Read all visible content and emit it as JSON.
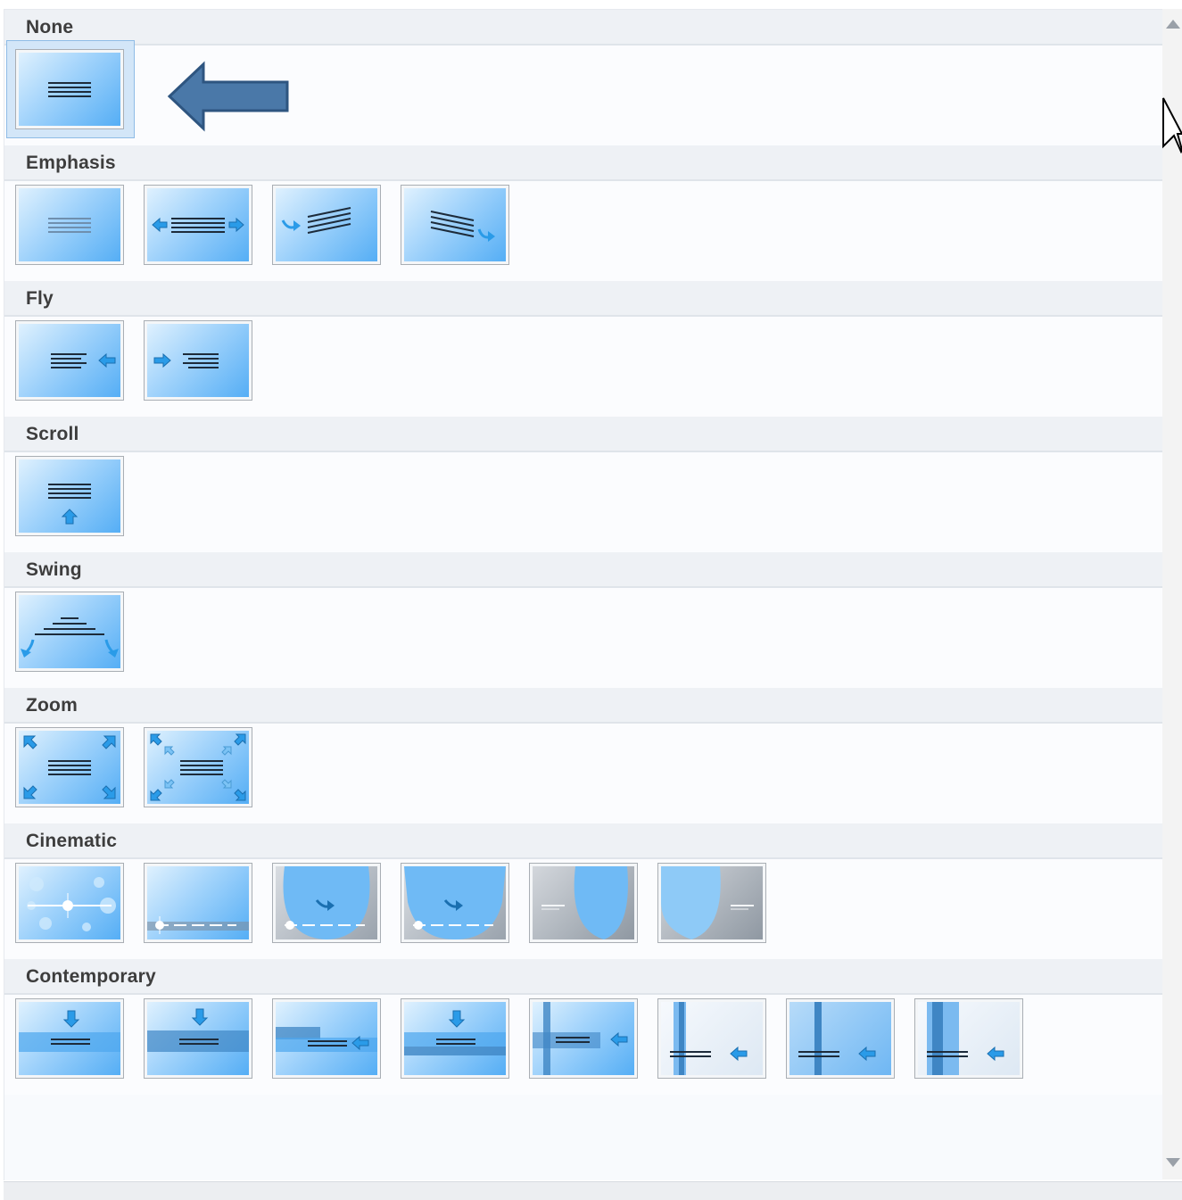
{
  "sections": [
    {
      "label": "None",
      "tiles": [
        {
          "name": "none",
          "selected": true
        }
      ]
    },
    {
      "label": "Emphasis",
      "tiles": [
        {
          "name": "emphasis-1"
        },
        {
          "name": "emphasis-2"
        },
        {
          "name": "emphasis-3"
        },
        {
          "name": "emphasis-4"
        }
      ]
    },
    {
      "label": "Fly",
      "tiles": [
        {
          "name": "fly-1"
        },
        {
          "name": "fly-2"
        }
      ]
    },
    {
      "label": "Scroll",
      "tiles": [
        {
          "name": "scroll-1"
        }
      ]
    },
    {
      "label": "Swing",
      "tiles": [
        {
          "name": "swing-1"
        }
      ]
    },
    {
      "label": "Zoom",
      "tiles": [
        {
          "name": "zoom-1"
        },
        {
          "name": "zoom-2"
        }
      ]
    },
    {
      "label": "Cinematic",
      "tiles": [
        {
          "name": "cinematic-1"
        },
        {
          "name": "cinematic-2"
        },
        {
          "name": "cinematic-3"
        },
        {
          "name": "cinematic-4"
        },
        {
          "name": "cinematic-5"
        },
        {
          "name": "cinematic-6"
        }
      ]
    },
    {
      "label": "Contemporary",
      "tiles": [
        {
          "name": "contemporary-1"
        },
        {
          "name": "contemporary-2"
        },
        {
          "name": "contemporary-3"
        },
        {
          "name": "contemporary-4"
        },
        {
          "name": "contemporary-5"
        },
        {
          "name": "contemporary-6"
        },
        {
          "name": "contemporary-7"
        },
        {
          "name": "contemporary-8"
        }
      ]
    }
  ],
  "annotation": {
    "icon": "left-arrow-icon",
    "color": "#4a78a8"
  },
  "colors": {
    "accent": "#55aef5",
    "selected": "#d3e6f8",
    "header": "#eef1f5"
  }
}
